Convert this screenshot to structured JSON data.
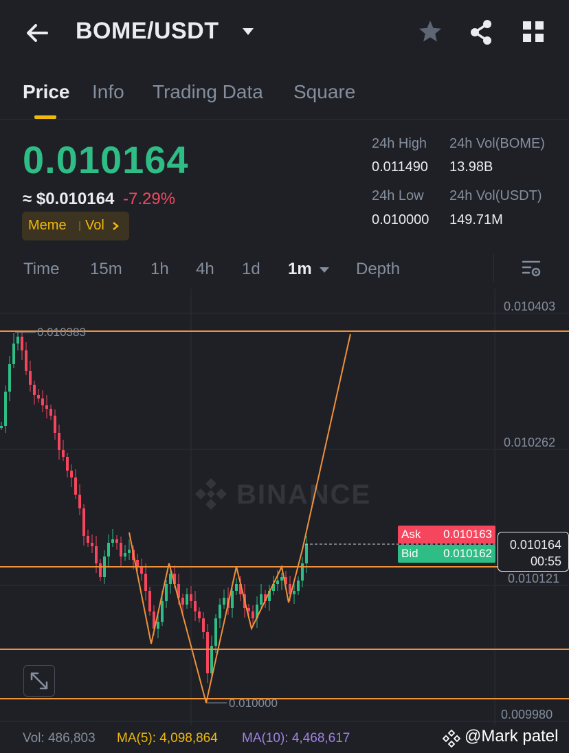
{
  "header": {
    "pair": "BOME/USDT",
    "icons": [
      "back-arrow-icon",
      "caret-down-icon",
      "star-icon",
      "share-icon",
      "grid-icon"
    ]
  },
  "tabs": [
    {
      "label": "Price",
      "active": true
    },
    {
      "label": "Info",
      "active": false
    },
    {
      "label": "Trading Data",
      "active": false
    },
    {
      "label": "Square",
      "active": false
    }
  ],
  "ticker": {
    "last_price": "0.010164",
    "usd_price": "≈ $0.010164",
    "change": "-7.29%",
    "tag_meme": "Meme",
    "tag_vol": "Vol",
    "high_label": "24h High",
    "high_value": "0.011490",
    "low_label": "24h Low",
    "low_value": "0.010000",
    "vol_base_label": "24h Vol(BOME)",
    "vol_base_value": "13.98B",
    "vol_quote_label": "24h Vol(USDT)",
    "vol_quote_value": "149.71M",
    "up_color": "#2ebd85",
    "down_color": "#f6465d"
  },
  "timeframes": [
    {
      "label": "Time",
      "active": false
    },
    {
      "label": "15m",
      "active": false
    },
    {
      "label": "1h",
      "active": false
    },
    {
      "label": "4h",
      "active": false
    },
    {
      "label": "1d",
      "active": false
    },
    {
      "label": "1m",
      "active": true
    },
    {
      "label": "Depth",
      "active": false
    }
  ],
  "chart": {
    "axis_labels": [
      "0.010403",
      "0.010262",
      "0.010121",
      "0.009980"
    ],
    "high_marker": "0.010383",
    "low_marker": "0.010000",
    "watermark": "BINANCE",
    "ask_label": "Ask",
    "ask_value": "0.010163",
    "bid_label": "Bid",
    "bid_value": "0.010162",
    "current_price": "0.010164",
    "countdown": "00:55",
    "annotation_color": "#f0913a"
  },
  "volume": {
    "vol": "Vol: 486,803",
    "ma5": "MA(5): 4,098,864",
    "ma10": "MA(10): 4,468,617"
  },
  "credit": "@Mark patel"
}
